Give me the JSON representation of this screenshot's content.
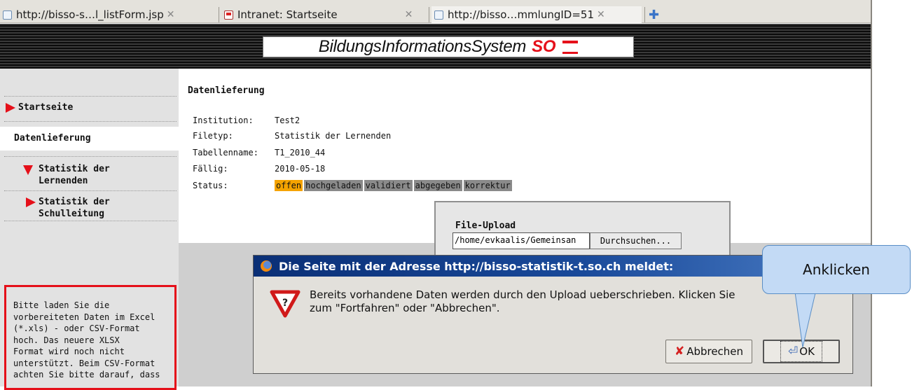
{
  "tabs": [
    {
      "label": "http://bisso-s…l_listForm.jsp",
      "close": "✕"
    },
    {
      "label": "Intranet: Startseite",
      "close": "✕"
    },
    {
      "label": "http://bisso…mmlungID=51",
      "close": "✕"
    }
  ],
  "new_tab": "✚",
  "banner": {
    "title_part1": "BildungsInformationsSystem",
    "title_part2": "SO"
  },
  "sidebar": {
    "items": [
      {
        "label": "Startseite"
      },
      {
        "label": "Datenlieferung"
      },
      {
        "label_line1": "Statistik der",
        "label_line2": "Lernenden"
      },
      {
        "label_line1": "Statistik der",
        "label_line2": "Schulleitung"
      }
    ],
    "info_lines": [
      "Bitte laden Sie die",
      "vorbereiteten Daten im Excel",
      "(*.xls) - oder CSV-Format",
      "hoch. Das neuere XLSX",
      "Format wird noch nicht",
      "unterstützt. Beim CSV-Format",
      "achten Sie bitte darauf, dass"
    ]
  },
  "main": {
    "heading": "Datenlieferung",
    "fields": [
      {
        "label": "Institution:",
        "value": "Test2"
      },
      {
        "label": "Filetyp:",
        "value": "Statistik der Lernenden"
      },
      {
        "label": "Tabellenname:",
        "value": "T1_2010_44"
      },
      {
        "label": "Fällig:",
        "value": "2010-05-18"
      },
      {
        "label": "Status:",
        "value": ""
      }
    ],
    "status_steps": [
      "offen",
      "hochgeladen",
      "validiert",
      "abgegeben",
      "korrektur"
    ],
    "status_active": "offen",
    "upload": {
      "heading": "File-Upload",
      "file_value": "/home/evkaalis/Gemeinsan",
      "browse_label": "Durchsuchen..."
    }
  },
  "dialog": {
    "title": "Die Seite mit der Adresse http://bisso-statistik-t.so.ch meldet:",
    "message_line1": "Bereits vorhandene Daten werden durch den Upload ueberschrieben. Klicken Sie",
    "message_line2": "zum \"Fortfahren\" oder \"Abbrechen\".",
    "cancel_label": "Abbrechen",
    "ok_label": "OK"
  },
  "callout": {
    "text": "Anklicken"
  },
  "colors": {
    "accent_red": "#e5101a",
    "status_active": "#f5a300",
    "status_inactive": "#8a8a8a",
    "dialog_title": "#0a2f76",
    "callout": "#c3daf5"
  }
}
